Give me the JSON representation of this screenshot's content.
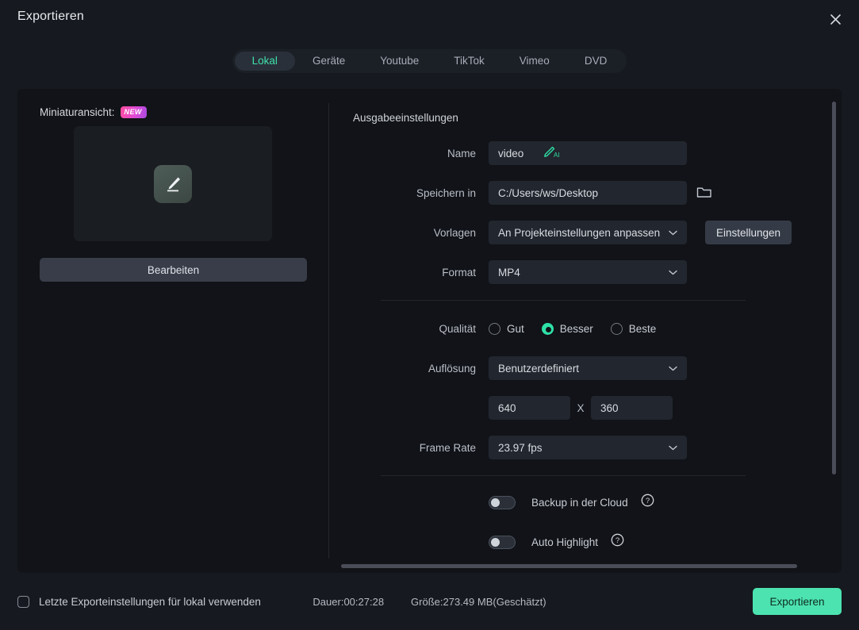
{
  "window": {
    "title": "Exportieren",
    "close_icon": "close-icon"
  },
  "tabs": [
    {
      "label": "Lokal",
      "active": true
    },
    {
      "label": "Geräte",
      "active": false
    },
    {
      "label": "Youtube",
      "active": false
    },
    {
      "label": "TikTok",
      "active": false
    },
    {
      "label": "Vimeo",
      "active": false
    },
    {
      "label": "DVD",
      "active": false
    }
  ],
  "thumbnail": {
    "label": "Miniaturansicht:",
    "badge": "NEW",
    "preview_icon": "edit-pencil-icon",
    "edit_button": "Bearbeiten"
  },
  "output": {
    "section_title": "Ausgabeeinstellungen",
    "name": {
      "label": "Name",
      "value": "video",
      "ai_icon": "ai-pencil-icon"
    },
    "save_in": {
      "label": "Speichern in",
      "value": "C:/Users/ws/Desktop",
      "folder_icon": "folder-icon"
    },
    "templates": {
      "label": "Vorlagen",
      "value": "An Projekteinstellungen anpassen",
      "settings_button": "Einstellungen"
    },
    "format": {
      "label": "Format",
      "value": "MP4"
    },
    "quality": {
      "label": "Qualität",
      "options": [
        {
          "label": "Gut",
          "selected": false
        },
        {
          "label": "Besser",
          "selected": true
        },
        {
          "label": "Beste",
          "selected": false
        }
      ]
    },
    "resolution": {
      "label": "Auflösung",
      "value": "Benutzerdefiniert"
    },
    "dimensions": {
      "width": "640",
      "separator": "X",
      "height": "360"
    },
    "frame_rate": {
      "label": "Frame Rate",
      "value": "23.97 fps"
    },
    "toggles": [
      {
        "label": "Backup in der Cloud",
        "enabled": false,
        "help_icon": "help-circle-icon"
      },
      {
        "label": "Auto Highlight",
        "enabled": false,
        "help_icon": "help-circle-icon"
      }
    ]
  },
  "footer": {
    "reuse_checkbox": {
      "label": "Letzte Exporteinstellungen für lokal verwenden",
      "checked": false
    },
    "duration": "Dauer:00:27:28",
    "size": "Größe:273.49 MB(Geschätzt)",
    "export_button": "Exportieren"
  },
  "colors": {
    "accent_green": "#4ce3b0",
    "tab_active_text": "#3fe0ac",
    "badge_gradient_start": "#ff4d9e",
    "badge_gradient_end": "#a94ae0",
    "dialog_bg": "#16191f",
    "panel_bg": "#111318"
  }
}
